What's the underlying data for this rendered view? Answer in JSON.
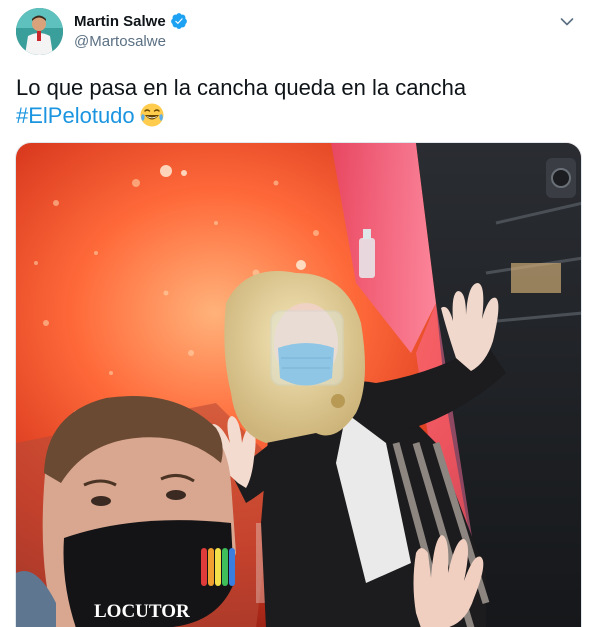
{
  "author": {
    "display_name": "Martin Salwe",
    "handle": "@Martosalwe",
    "verified": true
  },
  "tweet": {
    "text": "Lo que pasa en la cancha queda en la cancha",
    "hashtag": "#ElPelotudo",
    "emoji": "face-with-tears-of-joy"
  },
  "media": {
    "mask_text": "LOCUTOR"
  },
  "colors": {
    "text": "#0f1419",
    "secondary": "#5b7083",
    "link": "#1b95e0",
    "verified": "#1da1f2"
  },
  "icons": {
    "verified": "verified-badge-icon",
    "more": "chevron-down-icon"
  }
}
